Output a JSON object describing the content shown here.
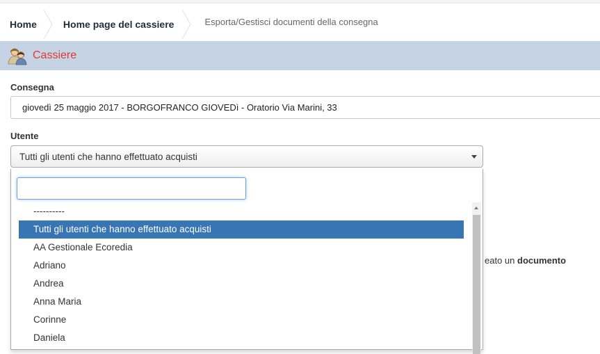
{
  "breadcrumb": {
    "items": [
      {
        "label": "Home"
      },
      {
        "label": "Home page del cassiere"
      }
    ],
    "current": "Esporta/Gestisci documenti della consegna"
  },
  "panel": {
    "title": "Cassiere",
    "icon": "users-icon"
  },
  "form": {
    "consegna_label": "Consegna",
    "consegna_value": "giovedì 25 maggio 2017 - BORGOFRANCO GIOVEDì - Oratorio Via Marini, 33",
    "utente_label": "Utente",
    "utente_value": "Tutti gli utenti che hanno effettuato acquisti"
  },
  "dropdown": {
    "search_value": "",
    "options": [
      {
        "label": "----------",
        "selected": false
      },
      {
        "label": "Tutti gli utenti che hanno effettuato acquisti",
        "selected": true
      },
      {
        "label": "AA Gestionale Ecoredia",
        "selected": false
      },
      {
        "label": "Adriano",
        "selected": false
      },
      {
        "label": "Andrea",
        "selected": false
      },
      {
        "label": "Anna Maria",
        "selected": false
      },
      {
        "label": "Corinne",
        "selected": false
      },
      {
        "label": "Daniela",
        "selected": false
      }
    ]
  },
  "background_text": {
    "prefix": "eato un ",
    "bold": "documento"
  },
  "colors": {
    "panel_header": "#c6d3e4",
    "panel_title": "#e03a32",
    "selected_option": "#3875b5"
  }
}
